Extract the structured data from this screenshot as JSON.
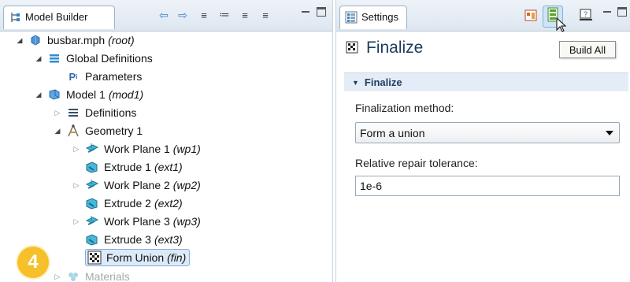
{
  "model_builder": {
    "tab_label": "Model Builder",
    "icons": [
      "arrow-left-icon",
      "arrow-right-icon",
      "expand-all-icon",
      "collapse-all-icon",
      "sort-up-icon",
      "sort-down-icon"
    ],
    "tree": [
      {
        "label": "busbar.mph",
        "tag": "(root)",
        "icon": "file-icon",
        "expanded": true
      },
      {
        "label": "Global Definitions",
        "tag": "",
        "icon": "global-icon",
        "expanded": true
      },
      {
        "label": "Parameters",
        "tag": "",
        "icon": "parameters-icon",
        "expanded": null
      },
      {
        "label": "Model 1",
        "tag": "(mod1)",
        "icon": "model-icon",
        "expanded": true
      },
      {
        "label": "Definitions",
        "tag": "",
        "icon": "definitions-icon",
        "expanded": false
      },
      {
        "label": "Geometry 1",
        "tag": "",
        "icon": "geometry-icon",
        "expanded": true
      },
      {
        "label": "Work Plane 1",
        "tag": "(wp1)",
        "icon": "workplane-icon",
        "expanded": false
      },
      {
        "label": "Extrude 1",
        "tag": "(ext1)",
        "icon": "extrude-icon",
        "expanded": null
      },
      {
        "label": "Work Plane 2",
        "tag": "(wp2)",
        "icon": "workplane-icon",
        "expanded": false
      },
      {
        "label": "Extrude 2",
        "tag": "(ext2)",
        "icon": "extrude-icon",
        "expanded": null
      },
      {
        "label": "Work Plane 3",
        "tag": "(wp3)",
        "icon": "workplane-icon",
        "expanded": false
      },
      {
        "label": "Extrude 3",
        "tag": "(ext3)",
        "icon": "extrude-icon",
        "expanded": null
      },
      {
        "label": "Form Union",
        "tag": "(fin)",
        "icon": "form-union-icon",
        "expanded": null,
        "selected": true
      },
      {
        "label": "Materials",
        "tag": "",
        "icon": "materials-icon",
        "expanded": false
      }
    ],
    "step_badge": "4"
  },
  "settings": {
    "tab_label": "Settings",
    "title": "Finalize",
    "section": "Finalize",
    "finalization_method_label": "Finalization method:",
    "finalization_method_value": "Form a union",
    "repair_tolerance_label": "Relative repair tolerance:",
    "repair_tolerance_value": "1e-6",
    "tooltip": "Build All"
  },
  "colors": {
    "accent": "#3c7fc1",
    "selection": "#dceaf8",
    "badge": "#f5c02a",
    "section_bar": "#e4edf7"
  }
}
